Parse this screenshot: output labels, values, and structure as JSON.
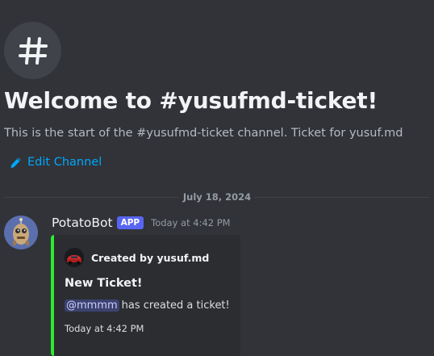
{
  "colors": {
    "background": "#313338",
    "link": "#00a8fc",
    "app_badge": "#5865f2",
    "embed_accent": "#2dec2d",
    "embed_bg": "#2b2d31",
    "mention_bg": "#3c4270"
  },
  "welcome": {
    "icon": "hashtag-icon",
    "title": "Welcome to #yusufmd-ticket!",
    "subtitle": "This is the start of the #yusufmd-ticket channel. Ticket for yusuf.md",
    "edit_icon": "pencil-icon",
    "edit_label": "Edit Channel"
  },
  "divider": {
    "date": "July 18, 2024"
  },
  "message": {
    "author": "PotatoBot",
    "badge": "APP",
    "timestamp": "Today at 4:42 PM",
    "avatar_icon": "robot-avatar-icon",
    "embed": {
      "author_icon": "car-avatar-icon",
      "author_name": "Created by yusuf.md",
      "title": "New Ticket!",
      "mention": "@mmmm",
      "description_rest": "has created a ticket!",
      "footer": "Today at 4:42 PM"
    }
  }
}
